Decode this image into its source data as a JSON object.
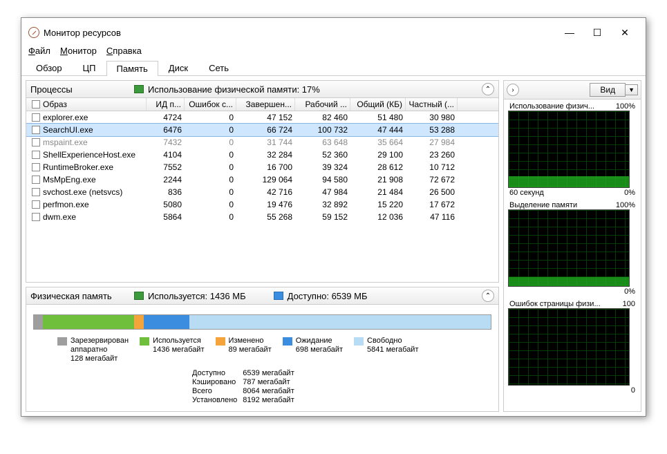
{
  "window": {
    "title": "Монитор ресурсов"
  },
  "menu": {
    "file": "Файл",
    "monitor": "Монитор",
    "help": "Справка",
    "file_u": "Ф",
    "monitor_u": "М",
    "help_u": "С"
  },
  "tabs": {
    "overview": "Обзор",
    "cpu": "ЦП",
    "memory": "Память",
    "disk": "Диск",
    "network": "Сеть"
  },
  "processes": {
    "title": "Процессы",
    "usage_label": "Использование физической памяти: 17%",
    "cols": [
      "Образ",
      "ИД п...",
      "Ошибок с...",
      "Завершен...",
      "Рабочий ...",
      "Общий (КБ)",
      "Частный (..."
    ],
    "rows": [
      {
        "img": "explorer.exe",
        "pid": "4724",
        "err": "0",
        "comp": "47 152",
        "ws": "82 460",
        "shared": "51 480",
        "priv": "30 980"
      },
      {
        "img": "SearchUI.exe",
        "pid": "6476",
        "err": "0",
        "comp": "66 724",
        "ws": "100 732",
        "shared": "47 444",
        "priv": "53 288",
        "sel": true
      },
      {
        "img": "mspaint.exe",
        "pid": "7432",
        "err": "0",
        "comp": "31 744",
        "ws": "63 648",
        "shared": "35 664",
        "priv": "27 984",
        "dim": true
      },
      {
        "img": "ShellExperienceHost.exe",
        "pid": "4104",
        "err": "0",
        "comp": "32 284",
        "ws": "52 360",
        "shared": "29 100",
        "priv": "23 260"
      },
      {
        "img": "RuntimeBroker.exe",
        "pid": "7552",
        "err": "0",
        "comp": "16 700",
        "ws": "39 324",
        "shared": "28 612",
        "priv": "10 712"
      },
      {
        "img": "MsMpEng.exe",
        "pid": "2244",
        "err": "0",
        "comp": "129 064",
        "ws": "94 580",
        "shared": "21 908",
        "priv": "72 672"
      },
      {
        "img": "svchost.exe (netsvcs)",
        "pid": "836",
        "err": "0",
        "comp": "42 716",
        "ws": "47 984",
        "shared": "21 484",
        "priv": "26 500"
      },
      {
        "img": "perfmon.exe",
        "pid": "5080",
        "err": "0",
        "comp": "19 476",
        "ws": "32 892",
        "shared": "15 220",
        "priv": "17 672"
      },
      {
        "img": "dwm.exe",
        "pid": "5864",
        "err": "0",
        "comp": "55 268",
        "ws": "59 152",
        "shared": "12 036",
        "priv": "47 116"
      }
    ]
  },
  "physmem": {
    "title": "Физическая память",
    "used_label": "Используется: 1436 МБ",
    "avail_label": "Доступно: 6539 МБ",
    "legend": [
      {
        "color": "#9e9e9e",
        "t1": "Зарезервирован",
        "t2": "аппаратно",
        "t3": "128 мегабайт"
      },
      {
        "color": "#6fbf3c",
        "t1": "Используется",
        "t2": "1436 мегабайт"
      },
      {
        "color": "#f4a43a",
        "t1": "Изменено",
        "t2": "89 мегабайт"
      },
      {
        "color": "#3b8de0",
        "t1": "Ожидание",
        "t2": "698 мегабайт"
      },
      {
        "color": "#b9dcf5",
        "t1": "Свободно",
        "t2": "5841 мегабайт"
      }
    ],
    "stats": {
      "labels": [
        "Доступно",
        "Кэшировано",
        "Всего",
        "Установлено"
      ],
      "vals": [
        "6539 мегабайт",
        "787 мегабайт",
        "8064 мегабайт",
        "8192 мегабайт"
      ]
    }
  },
  "side": {
    "view": "Вид",
    "charts": [
      {
        "title": "Использование физич...",
        "top": "100%",
        "foot_l": "60 секунд",
        "foot_r": "0%",
        "fill": 15
      },
      {
        "title": "Выделение памяти",
        "top": "100%",
        "foot_l": "",
        "foot_r": "0%",
        "fill": 12
      },
      {
        "title": "Ошибок страницы физи...",
        "top": "100",
        "foot_l": "",
        "foot_r": "0",
        "fill": 0
      }
    ]
  },
  "chart_data": [
    {
      "type": "line",
      "title": "Использование физической памяти",
      "ylim": [
        0,
        100
      ],
      "xlabel": "60 секунд",
      "ylabel": "%",
      "values_approx_pct": 17
    },
    {
      "type": "line",
      "title": "Выделение памяти",
      "ylim": [
        0,
        100
      ],
      "ylabel": "%",
      "values_approx_pct": 12
    },
    {
      "type": "line",
      "title": "Ошибок страницы физической памяти",
      "ylim": [
        0,
        100
      ],
      "values_approx": 0
    }
  ]
}
